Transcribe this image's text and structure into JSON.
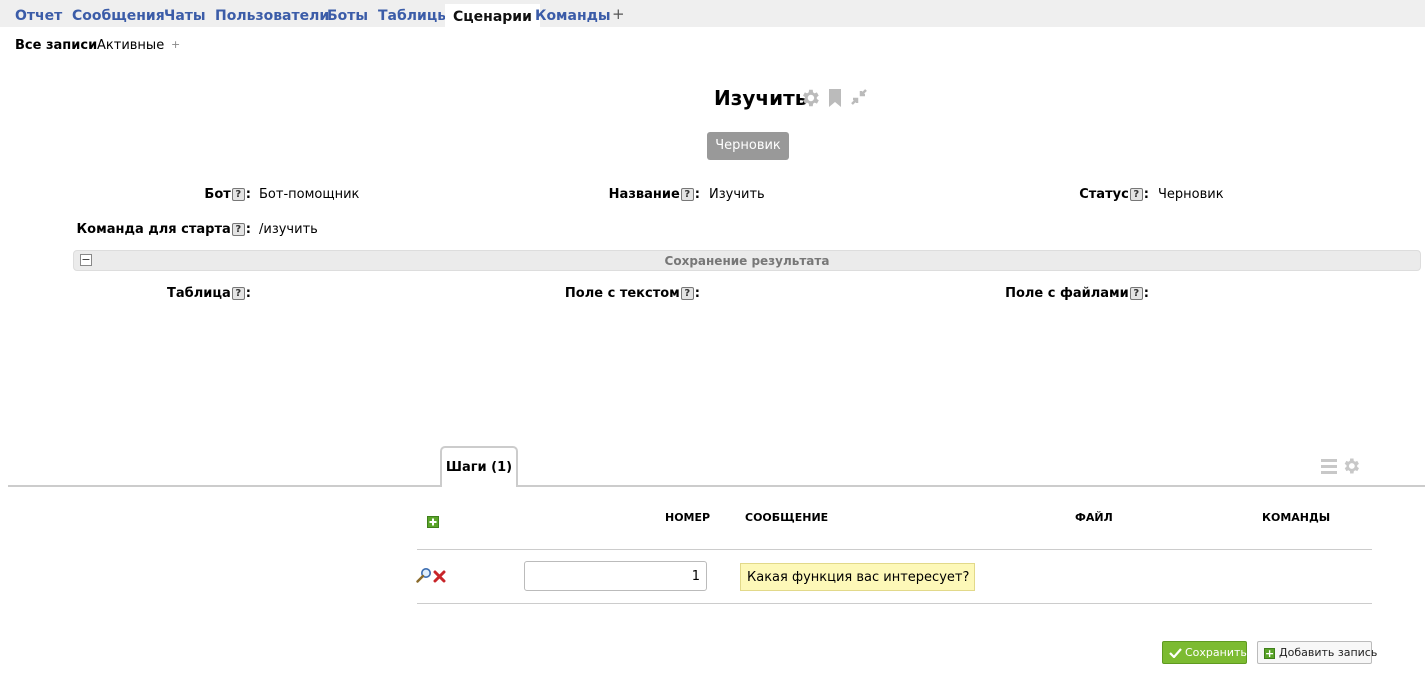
{
  "top_tabs": [
    {
      "label": "Отчет"
    },
    {
      "label": "Сообщения"
    },
    {
      "label": "Чаты"
    },
    {
      "label": "Пользователи"
    },
    {
      "label": "Боты"
    },
    {
      "label": "Таблицы"
    },
    {
      "label": "Сценарии",
      "active": true
    },
    {
      "label": "Команды"
    }
  ],
  "top_add_label": "+",
  "sub_tabs": [
    {
      "label": "Все записи",
      "active": true
    },
    {
      "label": "Активные"
    }
  ],
  "sub_add_label": "+",
  "record": {
    "title": "Изучить",
    "status_button": "Черновик"
  },
  "fields": {
    "bot": {
      "label": "Бот",
      "value": "Бот-помощник"
    },
    "name": {
      "label": "Название",
      "value": "Изучить"
    },
    "status": {
      "label": "Статус",
      "value": "Черновик"
    },
    "start_command": {
      "label": "Команда для старта",
      "value": "/изучить"
    },
    "help_glyph": "?",
    "colon": ":"
  },
  "section": {
    "title": "Сохранение результата",
    "toggle": "−",
    "fields": {
      "table": {
        "label": "Таблица"
      },
      "text_field": {
        "label": "Поле с текстом"
      },
      "files_field": {
        "label": "Поле с файлами"
      }
    }
  },
  "steps": {
    "tab_label": "Шаги (1)",
    "columns": {
      "number": "НОМЕР",
      "message": "СООБЩЕНИЕ",
      "file": "ФАЙЛ",
      "commands": "КОМАНДЫ"
    },
    "rows": [
      {
        "number": "1",
        "message": "Какая функция вас интересует?",
        "file": "",
        "commands": ""
      }
    ]
  },
  "buttons": {
    "save": "Сохранить",
    "add_record": "Добавить запись"
  },
  "colors": {
    "tab_link": "#3b5ca8",
    "save_green": "#7cbb31",
    "message_highlight": "#fdf8b8",
    "draft_gray": "#999999"
  }
}
